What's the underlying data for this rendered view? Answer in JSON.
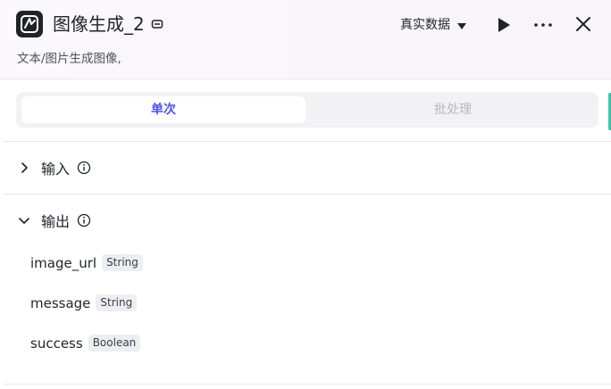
{
  "header": {
    "title": "图像生成_2",
    "subtitle": "文本/图片生成图像,",
    "data_mode": "真实数据"
  },
  "tabs": [
    {
      "label": "单次",
      "active": true
    },
    {
      "label": "批处理",
      "active": false
    }
  ],
  "sections": {
    "input": {
      "label": "输入",
      "expanded": false
    },
    "output": {
      "label": "输出",
      "expanded": true
    }
  },
  "outputs": [
    {
      "name": "image_url",
      "type": "String"
    },
    {
      "name": "message",
      "type": "String"
    },
    {
      "name": "success",
      "type": "Boolean"
    }
  ],
  "colors": {
    "accent": "#4d53e8",
    "icon_bg": "#1f2329",
    "edge_accent": "#3fc6a8"
  }
}
